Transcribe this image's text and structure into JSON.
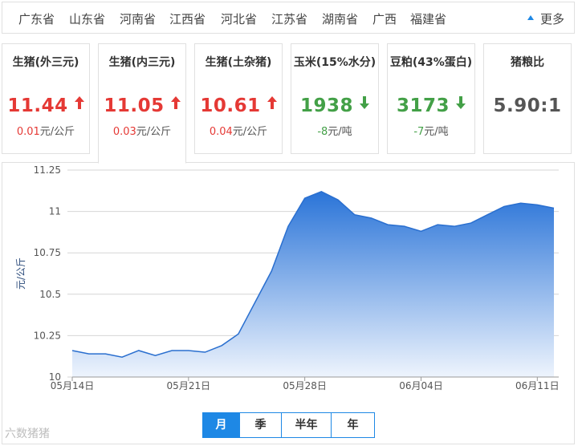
{
  "provinces": [
    "广东省",
    "山东省",
    "河南省",
    "江西省",
    "河北省",
    "江苏省",
    "湖南省",
    "广西",
    "福建省"
  ],
  "more_label": "更多",
  "cards": [
    {
      "title": "生猪(外三元)",
      "value": "11.44",
      "trend": "up",
      "change_value": "0.01",
      "change_unit": "元/公斤"
    },
    {
      "title": "生猪(内三元)",
      "value": "11.05",
      "trend": "up",
      "change_value": "0.03",
      "change_unit": "元/公斤"
    },
    {
      "title": "生猪(土杂猪)",
      "value": "10.61",
      "trend": "up",
      "change_value": "0.04",
      "change_unit": "元/公斤"
    },
    {
      "title": "玉米(15%水分)",
      "value": "1938",
      "trend": "down",
      "change_value": "-8",
      "change_unit": "元/吨"
    },
    {
      "title": "豆粕(43%蛋白)",
      "value": "3173",
      "trend": "down",
      "change_value": "-7",
      "change_unit": "元/吨"
    },
    {
      "title": "猪粮比",
      "value": "5.90:1",
      "trend": "none",
      "change_value": "",
      "change_unit": ""
    }
  ],
  "active_card_index": 1,
  "colors": {
    "up": "#e53935",
    "down": "#43a047",
    "accent": "#1e88e5",
    "area_top": "#2a74d8",
    "area_bottom": "#eef4fd"
  },
  "chart_data": {
    "type": "area",
    "title": "",
    "xlabel": "",
    "ylabel": "元/公斤",
    "ylim": [
      10,
      11.25
    ],
    "yticks": [
      "10",
      "10.25",
      "10.5",
      "10.75",
      "11",
      "11.25"
    ],
    "xticks": [
      "05月14日",
      "05月21日",
      "05月28日",
      "06月04日",
      "06月11日"
    ],
    "x": [
      "05-14",
      "05-15",
      "05-16",
      "05-17",
      "05-18",
      "05-19",
      "05-20",
      "05-21",
      "05-22",
      "05-23",
      "05-24",
      "05-25",
      "05-26",
      "05-27",
      "05-28",
      "05-29",
      "05-30",
      "05-31",
      "06-01",
      "06-02",
      "06-03",
      "06-04",
      "06-05",
      "06-06",
      "06-07",
      "06-08",
      "06-09",
      "06-10",
      "06-11",
      "06-12"
    ],
    "series": [
      {
        "values": [
          10.16,
          10.14,
          10.14,
          10.12,
          10.16,
          10.13,
          10.16,
          10.16,
          10.15,
          10.19,
          10.26,
          10.45,
          10.64,
          10.91,
          11.08,
          11.12,
          11.07,
          10.98,
          10.96,
          10.92,
          10.91,
          10.88,
          10.92,
          10.91,
          10.93,
          10.98,
          11.03,
          11.05,
          11.04,
          11.02
        ]
      }
    ],
    "last_value": 11.05,
    "grid": true,
    "legend": "none"
  },
  "periods": [
    "月",
    "季",
    "半年",
    "年"
  ],
  "active_period_index": 0,
  "watermark": "六数猪猪"
}
